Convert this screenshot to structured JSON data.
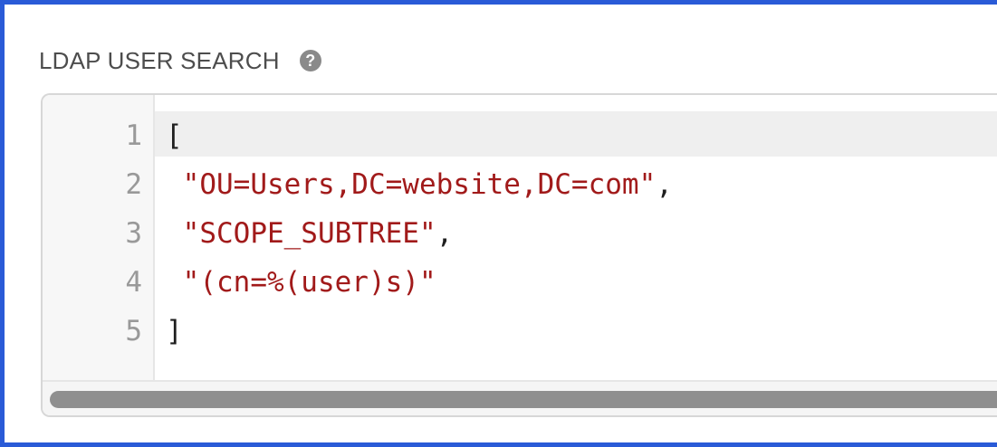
{
  "field": {
    "label": "LDAP USER SEARCH",
    "help_icon": "question-circle-icon",
    "help_glyph": "?"
  },
  "editor": {
    "lines": [
      {
        "number": "1",
        "tokens": [
          {
            "type": "punc",
            "text": "["
          }
        ]
      },
      {
        "number": "2",
        "tokens": [
          {
            "type": "str",
            "text": " \"OU=Users,DC=website,DC=com\""
          },
          {
            "type": "punc",
            "text": ","
          }
        ]
      },
      {
        "number": "3",
        "tokens": [
          {
            "type": "str",
            "text": " \"SCOPE_SUBTREE\""
          },
          {
            "type": "punc",
            "text": ","
          }
        ]
      },
      {
        "number": "4",
        "tokens": [
          {
            "type": "str",
            "text": " \"(cn=%(user)s)\""
          }
        ]
      },
      {
        "number": "5",
        "tokens": [
          {
            "type": "punc",
            "text": "]"
          }
        ]
      }
    ]
  },
  "colors": {
    "focus_border": "#2a5bd7",
    "string": "#a11a1a",
    "line_number": "#999999"
  }
}
